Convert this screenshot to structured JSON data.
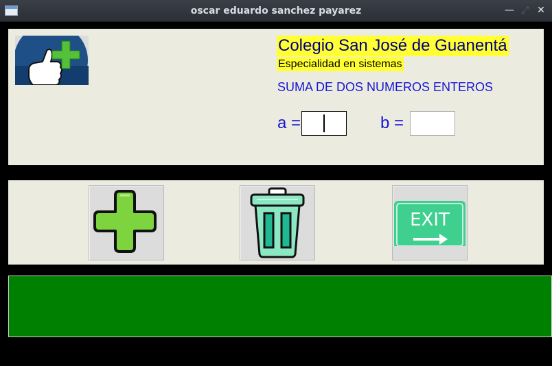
{
  "window": {
    "title": "oscar eduardo sanchez payarez"
  },
  "header": {
    "school": "Colegio San José de Guanentá",
    "specialty": "Especialidad en sistemas",
    "heading": "SUMA DE DOS NUMEROS ENTEROS"
  },
  "form": {
    "a_label": "a =",
    "a_value": "",
    "b_label": "b =",
    "b_value": ""
  },
  "buttons": {
    "add_icon": "plus-icon",
    "clear_icon": "trash-icon",
    "exit_icon": "exit-sign-icon",
    "exit_text": "EXIT"
  },
  "result": {
    "text": ""
  },
  "colors": {
    "panel": "#ecebe0",
    "highlight": "#ffff33",
    "label_blue": "#1515d6",
    "result_green": "#008000",
    "plus_green": "#7ed43e",
    "trash_mint": "#8be8c2",
    "exit_green": "#3fcf8e"
  }
}
